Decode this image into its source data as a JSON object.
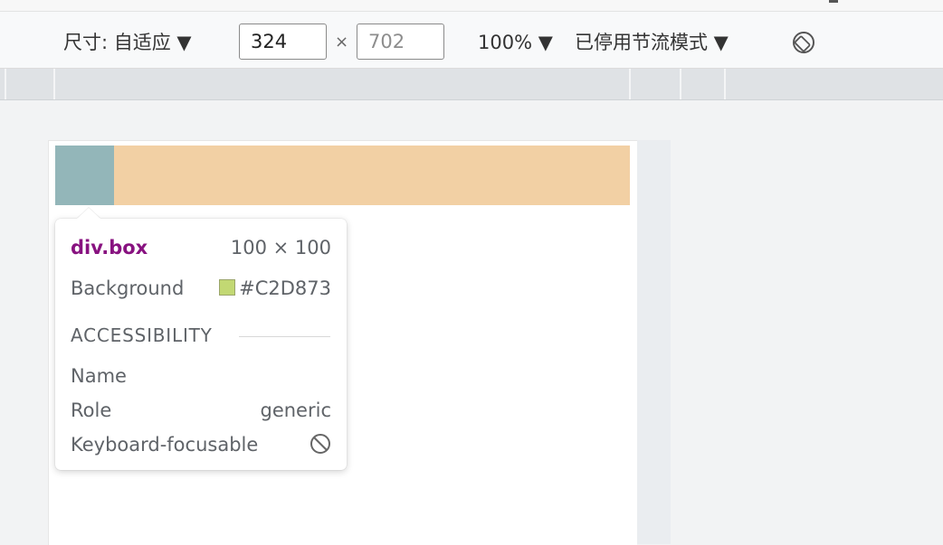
{
  "toolbar": {
    "dimensions_label": "尺寸: 自适应 ▼",
    "width_value": "324",
    "height_placeholder": "702",
    "times_symbol": "×",
    "zoom_label": "100% ▼",
    "throttle_label": "已停用节流模式 ▼",
    "rotate_icon": "rotate-icon"
  },
  "inspect_tooltip": {
    "selector_tag": "div",
    "selector_class": ".box",
    "size": "100 × 100",
    "background_label": "Background",
    "background_value": "#C2D873",
    "accessibility_title": "ACCESSIBILITY",
    "name_label": "Name",
    "role_label": "Role",
    "role_value": "generic",
    "focusable_label": "Keyboard-focusable",
    "focusable_icon": "not-allowed-icon"
  },
  "colors": {
    "box_highlight": "#93b6b9",
    "bar": "#f2d0a4",
    "swatch": "#c2d873",
    "selector": "#881280"
  }
}
